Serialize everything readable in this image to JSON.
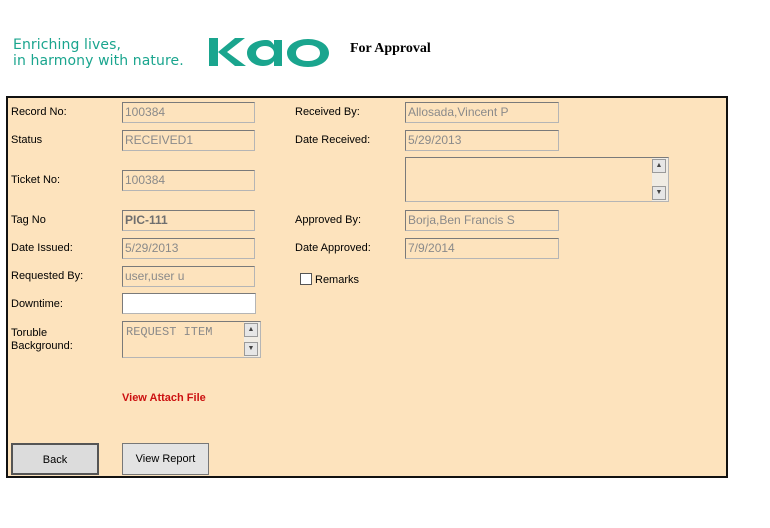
{
  "header": {
    "tagline_line1": "Enriching lives,",
    "tagline_line2": "in harmony with nature.",
    "logo_text": "kao",
    "page_title": "For Approval",
    "brand_color": "#1aa58e"
  },
  "form": {
    "record_no": {
      "label": "Record No:",
      "value": "100384"
    },
    "status": {
      "label": "Status",
      "value": "RECEIVED1"
    },
    "ticket_no": {
      "label": "Ticket No:",
      "value": "100384"
    },
    "tag_no": {
      "label": "Tag No",
      "value": "PIC-111"
    },
    "date_issued": {
      "label": "Date Issued:",
      "value": "5/29/2013"
    },
    "requested_by": {
      "label": "Requested By:",
      "value": "user,user u"
    },
    "downtime": {
      "label": "Downtime:",
      "value": ""
    },
    "trouble_background": {
      "label_line1": "Toruble",
      "label_line2": "Background:",
      "value": "REQUEST ITEM"
    },
    "received_by": {
      "label": "Received By:",
      "value": "Allosada,Vincent P"
    },
    "date_received": {
      "label": "Date Received:",
      "value": "5/29/2013"
    },
    "notes": {
      "value": ""
    },
    "approved_by": {
      "label": "Approved By:",
      "value": "Borja,Ben Francis S"
    },
    "date_approved": {
      "label": "Date Approved:",
      "value": "7/9/2014"
    },
    "remarks": {
      "label": "Remarks",
      "checked": false
    },
    "view_attach_label": "View Attach File",
    "panel_color": "#fde3bd",
    "link_color": "#cc1111"
  },
  "buttons": {
    "back_label": "Back",
    "view_report_label": "View Report"
  },
  "icons": {
    "scroll_up": "scroll-up-arrow",
    "scroll_down": "scroll-down-arrow"
  }
}
